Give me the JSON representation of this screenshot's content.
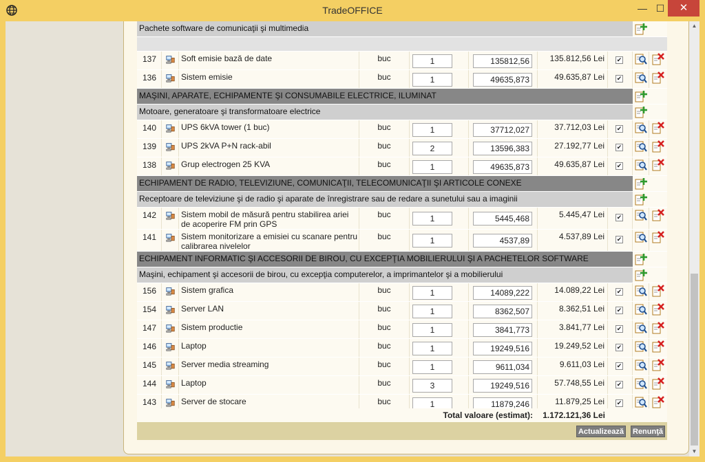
{
  "window": {
    "title": "TradeOFFICE",
    "min_glyph": "—",
    "max_glyph": "☐",
    "close_glyph": "✕"
  },
  "sections": [
    {
      "kind": "sub",
      "label": "Pachete software de comunicaţii şi multimedia"
    },
    {
      "kind": "spacer"
    },
    {
      "kind": "item",
      "id": "137",
      "name": "Soft emisie bază de date",
      "um": "buc",
      "qty": "1",
      "price": "135812,56",
      "total": "135.812,56 Lei"
    },
    {
      "kind": "item",
      "id": "136",
      "name": "Sistem emisie",
      "um": "buc",
      "qty": "1",
      "price": "49635,873",
      "total": "49.635,87 Lei"
    },
    {
      "kind": "cat",
      "label": "MAŞINI, APARATE, ECHIPAMENTE ŞI CONSUMABILE ELECTRICE, ILUMINAT"
    },
    {
      "kind": "sub",
      "label": "Motoare, generatoare şi transformatoare electrice"
    },
    {
      "kind": "item",
      "id": "140",
      "name": "UPS 6kVA tower (1 buc)",
      "um": "buc",
      "qty": "1",
      "price": "37712,027",
      "total": "37.712,03 Lei"
    },
    {
      "kind": "item",
      "id": "139",
      "name": "UPS 2kVA P+N rack-abil",
      "um": "buc",
      "qty": "2",
      "price": "13596,383",
      "total": "27.192,77 Lei"
    },
    {
      "kind": "item",
      "id": "138",
      "name": "Grup electrogen 25 KVA",
      "um": "buc",
      "qty": "1",
      "price": "49635,873",
      "total": "49.635,87 Lei"
    },
    {
      "kind": "cat",
      "label": "ECHIPAMENT DE RADIO, TELEVIZIUNE, COMUNICAŢII, TELECOMUNICAŢII ŞI ARTICOLE CONEXE"
    },
    {
      "kind": "sub",
      "label": "Receptoare de televiziune şi de radio şi aparate de înregistrare sau de redare a sunetului sau a imaginii"
    },
    {
      "kind": "item",
      "id": "142",
      "name": "Sistem mobil de măsură pentru stabilirea ariei de acoperire FM prin GPS",
      "um": "buc",
      "qty": "1",
      "price": "5445,468",
      "total": "5.445,47 Lei",
      "tall": true
    },
    {
      "kind": "item",
      "id": "141",
      "name": "Sistem monitorizare a emisiei cu scanare pentru calibrarea nivelelor",
      "um": "buc",
      "qty": "1",
      "price": "4537,89",
      "total": "4.537,89 Lei",
      "tall": true
    },
    {
      "kind": "cat",
      "label": "ECHIPAMENT INFORMATIC ŞI ACCESORII DE BIROU, CU EXCEPŢIA MOBILIERULUI ŞI A PACHETELOR SOFTWARE"
    },
    {
      "kind": "sub",
      "label": "Maşini, echipament şi accesorii de birou, cu excepţia computerelor, a imprimantelor şi a mobilierului"
    },
    {
      "kind": "item",
      "id": "156",
      "name": "Sistem grafica",
      "um": "buc",
      "qty": "1",
      "price": "14089,222",
      "total": "14.089,22 Lei"
    },
    {
      "kind": "item",
      "id": "154",
      "name": "Server LAN",
      "um": "buc",
      "qty": "1",
      "price": "8362,507",
      "total": "8.362,51 Lei"
    },
    {
      "kind": "item",
      "id": "147",
      "name": "Sistem productie",
      "um": "buc",
      "qty": "1",
      "price": "3841,773",
      "total": "3.841,77 Lei"
    },
    {
      "kind": "item",
      "id": "146",
      "name": "Laptop",
      "um": "buc",
      "qty": "1",
      "price": "19249,516",
      "total": "19.249,52 Lei"
    },
    {
      "kind": "item",
      "id": "145",
      "name": "Server media streaming",
      "um": "buc",
      "qty": "1",
      "price": "9611,034",
      "total": "9.611,03 Lei"
    },
    {
      "kind": "item",
      "id": "144",
      "name": "Laptop",
      "um": "buc",
      "qty": "3",
      "price": "19249,516",
      "total": "57.748,55 Lei"
    },
    {
      "kind": "item",
      "id": "143",
      "name": "Server de stocare",
      "um": "buc",
      "qty": "1",
      "price": "11879,246",
      "total": "11.879,25 Lei"
    }
  ],
  "summary": {
    "label": "Total valoare (estimat):",
    "value": "1.172.121,36 Lei"
  },
  "buttons": {
    "update": "Actualizează",
    "cancel": "Renunţă"
  },
  "colors": {
    "titlebar": "#f4cf63",
    "category": "#878787",
    "subcategory": "#cfcfcf",
    "close": "#c7453a",
    "button": "#7d7d7d"
  },
  "icons": {
    "app": "globe-icon",
    "item": "computer-icon",
    "edit": "search-edit-icon",
    "delete": "delete-icon",
    "add": "add-icon"
  }
}
